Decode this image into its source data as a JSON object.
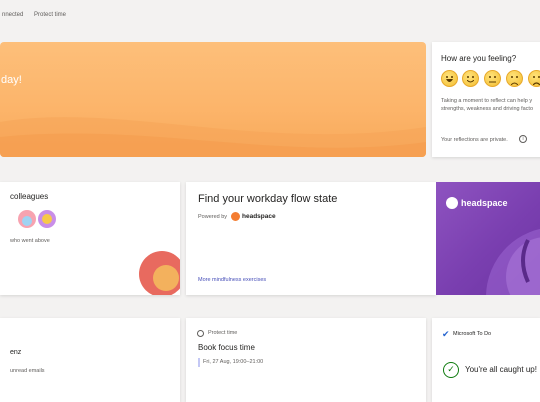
{
  "topbar": {
    "item1": "nnected",
    "item2": "Protect time"
  },
  "banner": {
    "text": "day!"
  },
  "feeling": {
    "title": "How are you feeling?",
    "desc_line1": "Taking a moment to reflect can help y",
    "desc_line2": "strengths, weakness and driving facto",
    "private_note": "Your reflections are private."
  },
  "colleagues": {
    "title": "colleagues",
    "subtitle": "who went above"
  },
  "flow": {
    "title": "Find your workday flow state",
    "powered_by": "Powered by",
    "brand": "headspace",
    "more_link": "More mindfulness exercises"
  },
  "headspace_image": {
    "brand": "headspace"
  },
  "bottom": {
    "card1_name": "enz",
    "card1_sub": "unread emails",
    "protect_label": "Protect time",
    "focus_title": "Book focus time",
    "focus_time": "Fri, 27 Aug, 19:00–21:00",
    "todo_label": "Microsoft To Do",
    "caught_up": "You're all caught up!"
  },
  "colors": {
    "accent": "#464eb8",
    "banner": "#fcb56b",
    "headspace_purple": "#7a3fb0",
    "success": "#107c10"
  }
}
